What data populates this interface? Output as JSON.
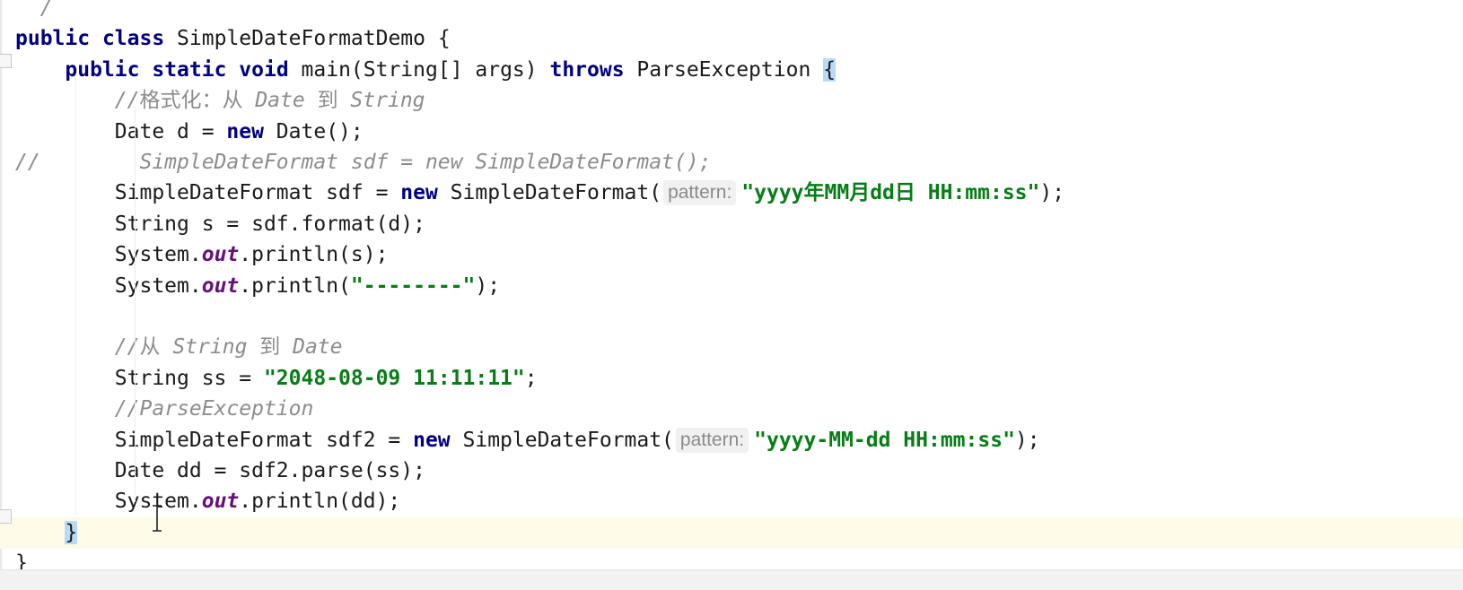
{
  "editor": {
    "file_class_name": "SimpleDateFormatDemo",
    "lines": [
      {
        "id": "line-0",
        "parts": [
          {
            "t": "  /",
            "c": "comment"
          }
        ]
      },
      {
        "id": "line-1",
        "parts": [
          {
            "t": "public",
            "c": "kw"
          },
          {
            "t": " ",
            "c": "plain"
          },
          {
            "t": "class",
            "c": "kw"
          },
          {
            "t": " SimpleDateFormatDemo {",
            "c": "plain"
          }
        ]
      },
      {
        "id": "line-2",
        "parts": [
          {
            "t": "    ",
            "c": "plain"
          },
          {
            "t": "public",
            "c": "kw"
          },
          {
            "t": " ",
            "c": "plain"
          },
          {
            "t": "static",
            "c": "kw"
          },
          {
            "t": " ",
            "c": "plain"
          },
          {
            "t": "void",
            "c": "kw"
          },
          {
            "t": " main(String[] args) ",
            "c": "plain"
          },
          {
            "t": "throws",
            "c": "kw"
          },
          {
            "t": " ParseException ",
            "c": "plain"
          },
          {
            "t": "{",
            "c": "brace"
          }
        ]
      },
      {
        "id": "line-3",
        "parts": [
          {
            "t": "        ",
            "c": "plain"
          },
          {
            "t": "//",
            "c": "comment"
          },
          {
            "t": "格式化：从",
            "c": "comment-cjk"
          },
          {
            "t": " Date ",
            "c": "comment"
          },
          {
            "t": "到",
            "c": "comment-cjk"
          },
          {
            "t": " String",
            "c": "comment"
          }
        ]
      },
      {
        "id": "line-4",
        "parts": [
          {
            "t": "        Date d = ",
            "c": "plain"
          },
          {
            "t": "new",
            "c": "kw"
          },
          {
            "t": " Date();",
            "c": "plain"
          }
        ]
      },
      {
        "id": "line-5",
        "parts": [
          {
            "t": "//        SimpleDateFormat sdf = new SimpleDateFormat();",
            "c": "comment"
          }
        ]
      },
      {
        "id": "line-6",
        "parts": [
          {
            "t": "        SimpleDateFormat sdf = ",
            "c": "plain"
          },
          {
            "t": "new",
            "c": "kw"
          },
          {
            "t": " SimpleDateFormat(",
            "c": "plain"
          },
          {
            "t": "pattern:",
            "c": "hint"
          },
          {
            "t": "\"yyyy年MM月dd日 HH:mm:ss\"",
            "c": "str"
          },
          {
            "t": ");",
            "c": "plain"
          }
        ]
      },
      {
        "id": "line-7",
        "parts": [
          {
            "t": "        String s = sdf.format(d);",
            "c": "plain"
          }
        ]
      },
      {
        "id": "line-8",
        "parts": [
          {
            "t": "        System.",
            "c": "plain"
          },
          {
            "t": "out",
            "c": "field"
          },
          {
            "t": ".println(s);",
            "c": "plain"
          }
        ]
      },
      {
        "id": "line-9",
        "parts": [
          {
            "t": "        System.",
            "c": "plain"
          },
          {
            "t": "out",
            "c": "field"
          },
          {
            "t": ".println(",
            "c": "plain"
          },
          {
            "t": "\"--------\"",
            "c": "str"
          },
          {
            "t": ");",
            "c": "plain"
          }
        ]
      },
      {
        "id": "line-10",
        "parts": []
      },
      {
        "id": "line-11",
        "parts": [
          {
            "t": "        ",
            "c": "plain"
          },
          {
            "t": "//",
            "c": "comment"
          },
          {
            "t": "从",
            "c": "comment-cjk"
          },
          {
            "t": " String ",
            "c": "comment"
          },
          {
            "t": "到",
            "c": "comment-cjk"
          },
          {
            "t": " Date",
            "c": "comment"
          }
        ]
      },
      {
        "id": "line-12",
        "parts": [
          {
            "t": "        String ss = ",
            "c": "plain"
          },
          {
            "t": "\"2048-08-09 11:11:11\"",
            "c": "str"
          },
          {
            "t": ";",
            "c": "plain"
          }
        ]
      },
      {
        "id": "line-13",
        "parts": [
          {
            "t": "        //ParseException",
            "c": "comment"
          }
        ]
      },
      {
        "id": "line-14",
        "parts": [
          {
            "t": "        SimpleDateFormat sdf2 = ",
            "c": "plain"
          },
          {
            "t": "new",
            "c": "kw"
          },
          {
            "t": " SimpleDateFormat(",
            "c": "plain"
          },
          {
            "t": "pattern:",
            "c": "hint"
          },
          {
            "t": "\"yyyy-MM-dd HH:mm:ss\"",
            "c": "str"
          },
          {
            "t": ");",
            "c": "plain"
          }
        ]
      },
      {
        "id": "line-15",
        "parts": [
          {
            "t": "        Date dd = sdf2.parse(ss);",
            "c": "plain"
          }
        ]
      },
      {
        "id": "line-16",
        "parts": [
          {
            "t": "        System.",
            "c": "plain"
          },
          {
            "t": "out",
            "c": "field"
          },
          {
            "t": ".println(dd);",
            "c": "plain"
          }
        ]
      },
      {
        "id": "line-17",
        "current": true,
        "parts": [
          {
            "t": "    ",
            "c": "plain"
          },
          {
            "t": "}",
            "c": "brace"
          }
        ]
      },
      {
        "id": "line-18",
        "parts": [
          {
            "t": "}",
            "c": "plain"
          }
        ]
      }
    ]
  },
  "colors": {
    "keyword": "#000080",
    "string": "#067d17",
    "comment": "#8c8c8c",
    "static_field": "#660e7a",
    "brace_match_bg": "#b9d9f5",
    "current_line_bg": "#fdfbe8"
  },
  "icons": {
    "cursor": "i-beam-text-cursor-icon",
    "fold": "fold-marker-icon"
  }
}
